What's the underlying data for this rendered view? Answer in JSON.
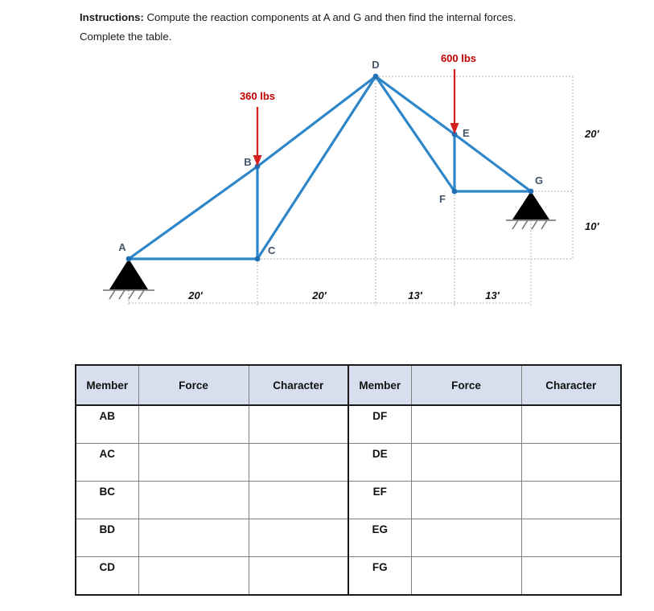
{
  "instructions": {
    "lead": "Instructions:",
    "body": " Compute the reaction components at A and G and then find the internal forces.",
    "line2": "Complete the table."
  },
  "figure": {
    "nodes": [
      {
        "id": "A",
        "label": "A"
      },
      {
        "id": "B",
        "label": "B"
      },
      {
        "id": "C",
        "label": "C"
      },
      {
        "id": "D",
        "label": "D"
      },
      {
        "id": "E",
        "label": "E"
      },
      {
        "id": "F",
        "label": "F"
      },
      {
        "id": "G",
        "label": "G"
      }
    ],
    "loads": [
      {
        "at": "B",
        "label": "360 lbs"
      },
      {
        "at": "E",
        "label": "600 lbs"
      }
    ],
    "horizontal_dimensions": [
      "20'",
      "20'",
      "13'",
      "13'"
    ],
    "vertical_dimensions": [
      "20'",
      "10'"
    ],
    "supports": [
      "A",
      "G"
    ],
    "member_color": "#2E86C8",
    "load_color": "#c00000",
    "node_label_color": "#44546a"
  },
  "table": {
    "headers": [
      "Member",
      "Force",
      "Character",
      "Member",
      "Force",
      "Character"
    ],
    "rows": [
      {
        "left_member": "AB",
        "left_force": "",
        "left_character": "",
        "right_member": "DF",
        "right_force": "",
        "right_character": ""
      },
      {
        "left_member": "AC",
        "left_force": "",
        "left_character": "",
        "right_member": "DE",
        "right_force": "",
        "right_character": ""
      },
      {
        "left_member": "BC",
        "left_force": "",
        "left_character": "",
        "right_member": "EF",
        "right_force": "",
        "right_character": ""
      },
      {
        "left_member": "BD",
        "left_force": "",
        "left_character": "",
        "right_member": "EG",
        "right_force": "",
        "right_character": ""
      },
      {
        "left_member": "CD",
        "left_force": "",
        "left_character": "",
        "right_member": "FG",
        "right_force": "",
        "right_character": ""
      }
    ]
  }
}
